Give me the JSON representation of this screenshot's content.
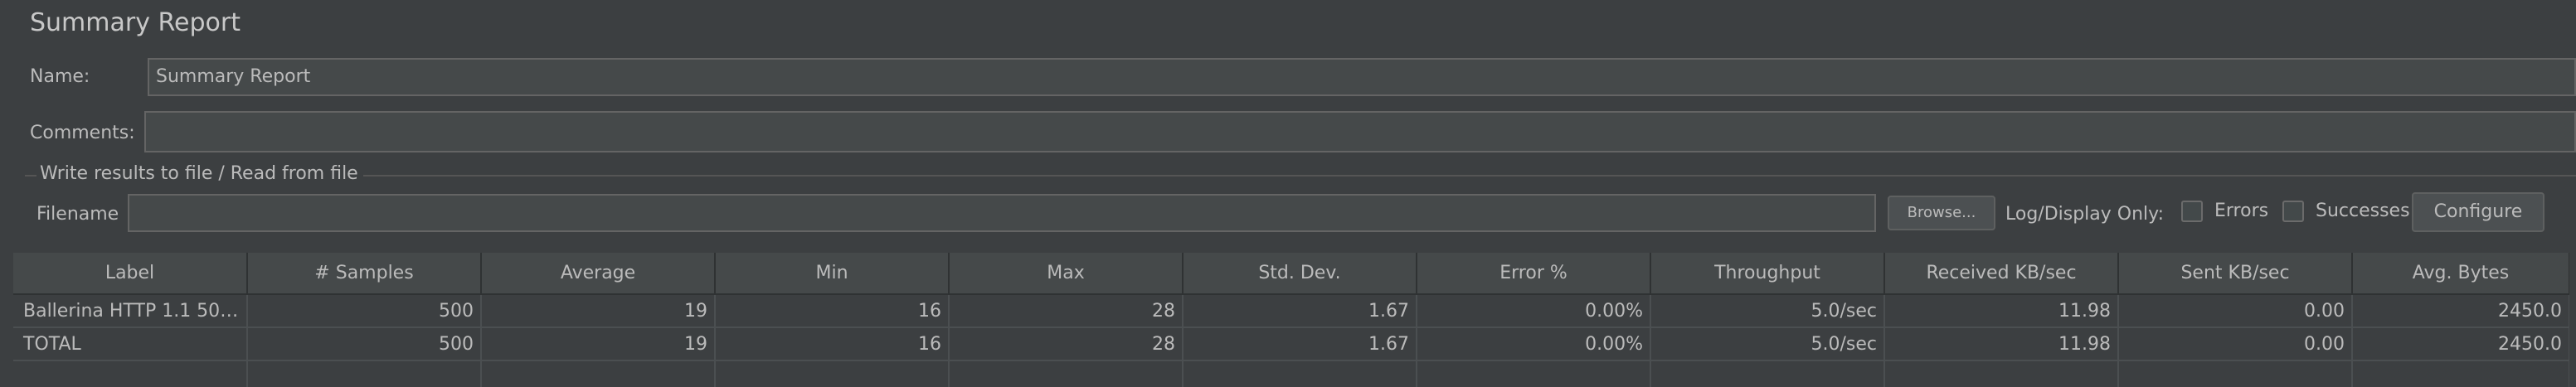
{
  "panel": {
    "title": "Summary Report"
  },
  "name_field": {
    "label": "Name:",
    "value": "Summary Report"
  },
  "comments_field": {
    "label": "Comments:",
    "value": ""
  },
  "file_group": {
    "title": "Write results to file / Read from file",
    "filename_label": "Filename",
    "filename_value": "",
    "browse_label": "Browse...",
    "log_display_label": "Log/Display Only:",
    "errors_label": "Errors",
    "errors_checked": false,
    "successes_label": "Successes",
    "successes_checked": false,
    "configure_label": "Configure"
  },
  "table": {
    "columns": [
      "Label",
      "# Samples",
      "Average",
      "Min",
      "Max",
      "Std. Dev.",
      "Error %",
      "Throughput",
      "Received KB/sec",
      "Sent KB/sec",
      "Avg. Bytes"
    ],
    "rows": [
      [
        "Ballerina HTTP 1.1 500 ...",
        "500",
        "19",
        "16",
        "28",
        "1.67",
        "0.00%",
        "5.0/sec",
        "11.98",
        "0.00",
        "2450.0"
      ],
      [
        "TOTAL",
        "500",
        "19",
        "16",
        "28",
        "1.67",
        "0.00%",
        "5.0/sec",
        "11.98",
        "0.00",
        "2450.0"
      ],
      [
        "",
        "",
        "",
        "",
        "",
        "",
        "",
        "",
        "",
        "",
        ""
      ]
    ]
  }
}
